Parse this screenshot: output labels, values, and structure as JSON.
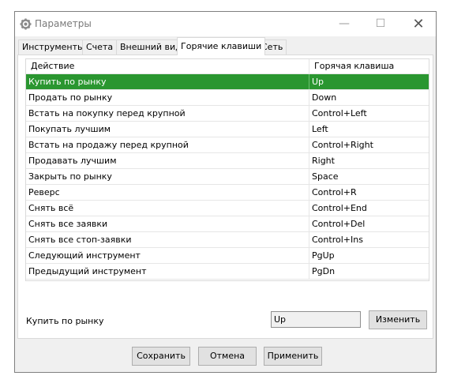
{
  "window": {
    "title": "Параметры",
    "icon": "gear-icon",
    "minimize_glyph": "—",
    "maximize_glyph": "☐",
    "close_glyph": "✕"
  },
  "tabs": [
    {
      "label": "Инструменты"
    },
    {
      "label": "Счета"
    },
    {
      "label": "Внешний вид"
    },
    {
      "label": "Горячие клавиши",
      "active": true
    },
    {
      "label": "Сеть"
    }
  ],
  "table": {
    "headers": [
      "Действие",
      "Горячая клавиша"
    ],
    "rows": [
      {
        "action": "Купить по рынку",
        "key": "Up",
        "selected": true
      },
      {
        "action": "Продать по рынку",
        "key": "Down"
      },
      {
        "action": "Встать на покупку перед крупной",
        "key": "Control+Left"
      },
      {
        "action": "Покупать лучшим",
        "key": "Left"
      },
      {
        "action": "Встать на продажу перед крупной",
        "key": "Control+Right"
      },
      {
        "action": "Продавать лучшим",
        "key": "Right"
      },
      {
        "action": "Закрыть по рынку",
        "key": "Space"
      },
      {
        "action": "Реверс",
        "key": "Control+R"
      },
      {
        "action": "Снять всё",
        "key": "Control+End"
      },
      {
        "action": "Снять все заявки",
        "key": "Control+Del"
      },
      {
        "action": "Снять все стоп-заявки",
        "key": "Control+Ins"
      },
      {
        "action": "Следующий инструмент",
        "key": "PgUp"
      },
      {
        "action": "Предыдущий инструмент",
        "key": "PgDn"
      }
    ]
  },
  "editor": {
    "label": "Купить по рынку",
    "value": "Up",
    "change_label": "Изменить"
  },
  "footer": {
    "save_label": "Сохранить",
    "cancel_label": "Отмена",
    "apply_label": "Применить"
  },
  "colors": {
    "selected_row": "#2a9630",
    "window_bg": "#f0f0f0"
  }
}
